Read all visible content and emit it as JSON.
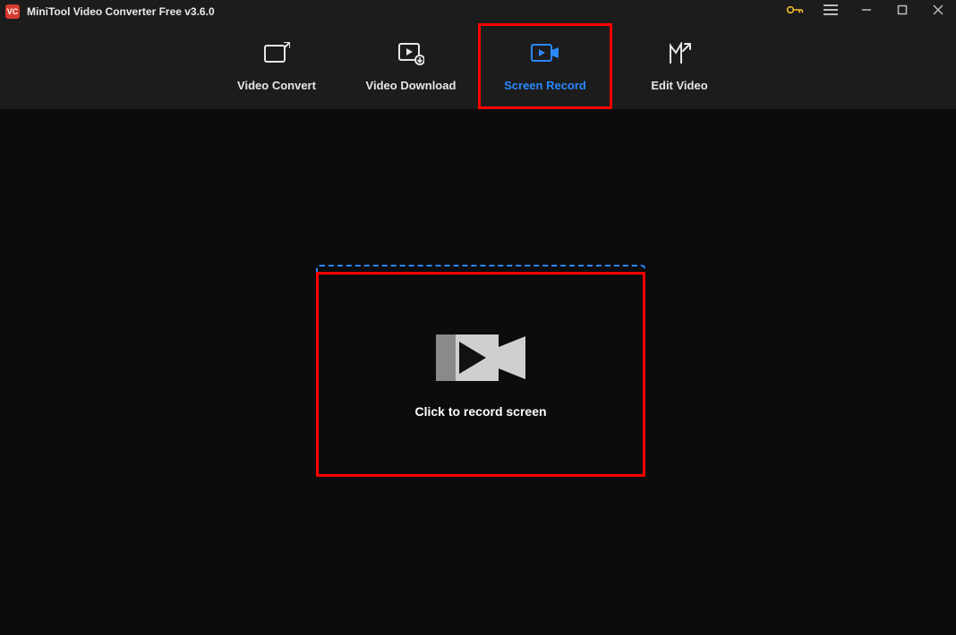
{
  "window": {
    "title": "MiniTool Video Converter Free v3.6.0",
    "app_icon_text": "VC"
  },
  "tabs": {
    "video_convert": "Video Convert",
    "video_download": "Video Download",
    "screen_record": "Screen Record",
    "edit_video": "Edit Video"
  },
  "main": {
    "record_prompt": "Click to record screen"
  }
}
